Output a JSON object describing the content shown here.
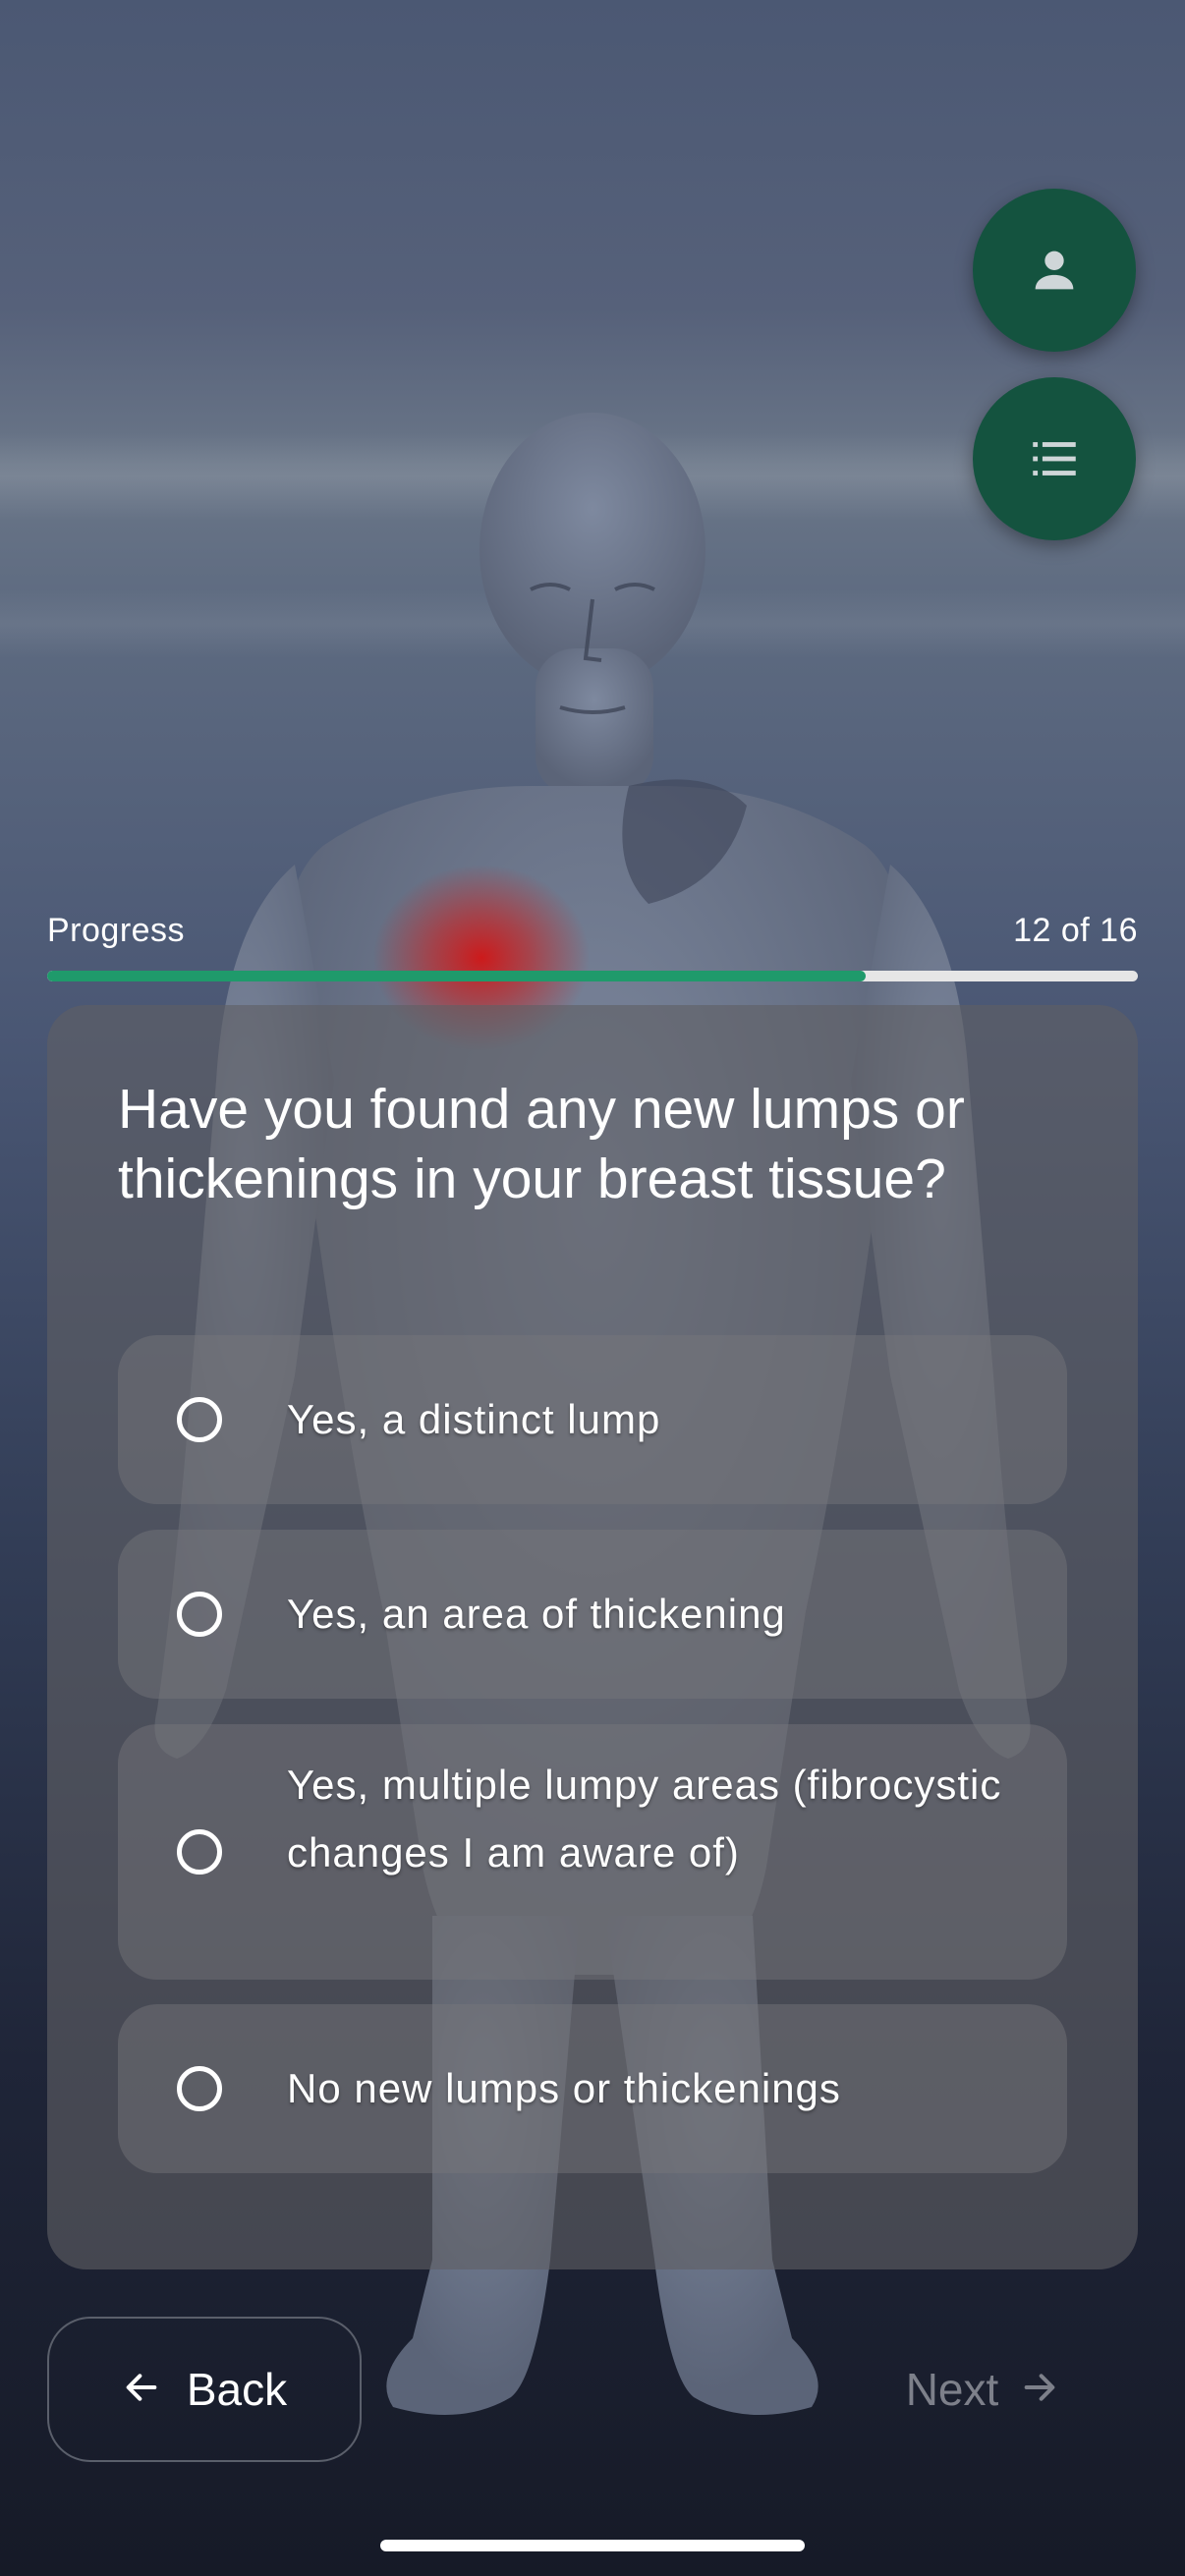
{
  "progress": {
    "label": "Progress",
    "count_text": "12 of 16",
    "current": 12,
    "total": 16,
    "fraction": 0.75
  },
  "question": {
    "text": "Have you found any new lumps or thickenings in your breast tissue?"
  },
  "options": [
    {
      "label": "Yes, a distinct lump",
      "selected": false
    },
    {
      "label": "Yes, an area of thickening",
      "selected": false
    },
    {
      "label": "Yes, multiple lumpy areas (fibrocystic changes I am aware of)",
      "selected": false
    },
    {
      "label": "No new lumps or thickenings",
      "selected": false
    }
  ],
  "nav": {
    "back_label": "Back",
    "next_label": "Next"
  },
  "fabs": {
    "profile_icon": "person-icon",
    "list_icon": "list-icon",
    "color": "#14533f"
  },
  "colors": {
    "progress_fill": "#1f9a6b",
    "progress_track": "#e6e6e6",
    "highlight": "#d01818"
  }
}
